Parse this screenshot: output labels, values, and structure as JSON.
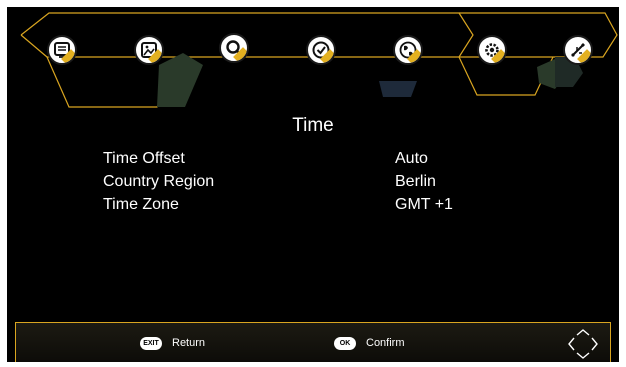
{
  "screen": {
    "title": "Time"
  },
  "menu_icons": [
    {
      "name": "program-icon"
    },
    {
      "name": "picture-icon"
    },
    {
      "name": "search-icon"
    },
    {
      "name": "time-icon",
      "selected": true
    },
    {
      "name": "globe-icon"
    },
    {
      "name": "gear-icon"
    },
    {
      "name": "usb-icon"
    }
  ],
  "settings": [
    {
      "label": "Time Offset",
      "value": "Auto"
    },
    {
      "label": "Country Region",
      "value": "Berlin"
    },
    {
      "label": "Time Zone",
      "value": "GMT +1"
    }
  ],
  "footer": {
    "exit_key": "EXIT",
    "exit_label": "Return",
    "ok_key": "OK",
    "ok_label": "Confirm"
  },
  "colors": {
    "accent": "#e3b020",
    "background": "#000000",
    "text": "#ffffff"
  }
}
